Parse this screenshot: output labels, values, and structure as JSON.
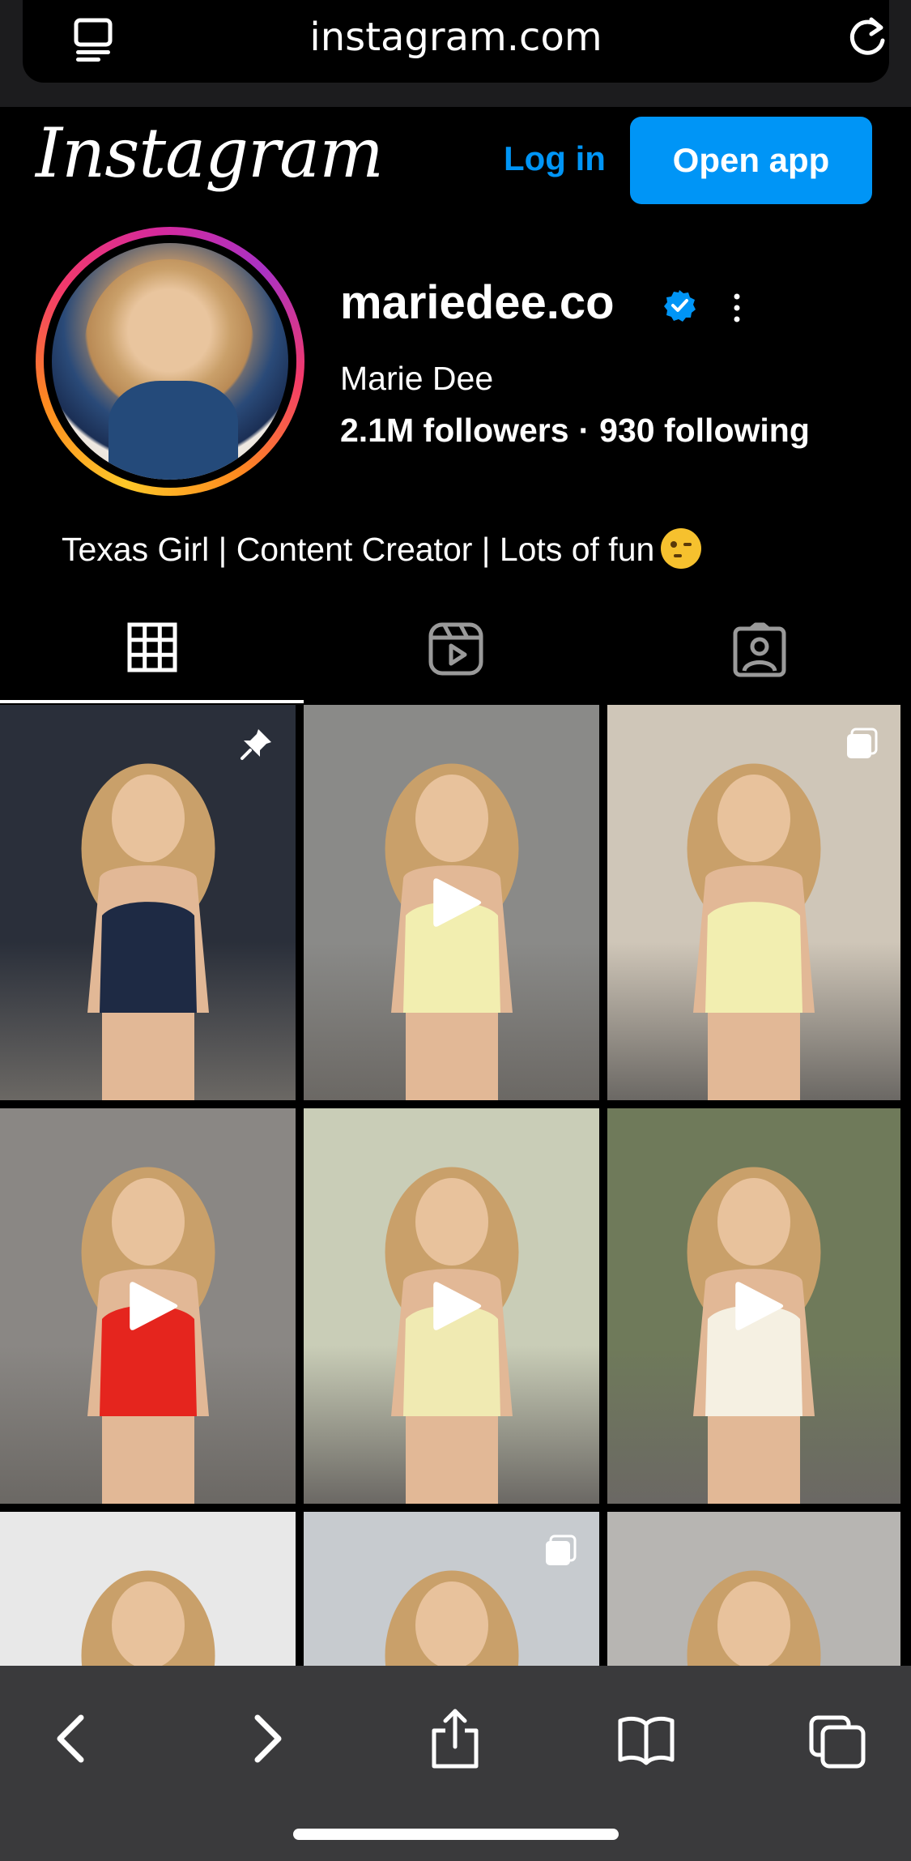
{
  "browser": {
    "url": "instagram.com",
    "reader_icon": "reader-mode-icon",
    "reload_icon": "reload-icon"
  },
  "header": {
    "logo_text": "Instagram",
    "login_label": "Log in",
    "open_app_label": "Open app",
    "accent_color": "#0095f6"
  },
  "profile": {
    "username": "mariedee.co",
    "verified": true,
    "full_name": "Marie Dee",
    "followers": "2.1M followers",
    "separator": "·",
    "following": "930 following",
    "bio": "Texas Girl | Content Creator | Lots of fun"
  },
  "tabs": [
    {
      "name": "posts",
      "icon": "grid-icon",
      "active": true
    },
    {
      "name": "reels",
      "icon": "reels-icon",
      "active": false
    },
    {
      "name": "tagged",
      "icon": "tagged-icon",
      "active": false
    }
  ],
  "posts": [
    {
      "type": "pinned",
      "bg": "#2a2f3a",
      "outfit": "#1e2a44"
    },
    {
      "type": "reel",
      "bg": "#8a8a88",
      "outfit": "#f2eeb0"
    },
    {
      "type": "carousel",
      "bg": "#cfc6b8",
      "outfit": "#f2eeb0"
    },
    {
      "type": "reel",
      "bg": "#8a8784",
      "outfit": "#e5251e"
    },
    {
      "type": "reel",
      "bg": "#c9cdb7",
      "outfit": "#f0eab2"
    },
    {
      "type": "reel",
      "bg": "#6f7a5a",
      "outfit": "#f5f0e2"
    },
    {
      "type": "photo",
      "bg": "#e8e8e8",
      "outfit": "#e9e5e0"
    },
    {
      "type": "carousel",
      "bg": "#c7cbcf",
      "outfit": "#ddd5cc"
    },
    {
      "type": "photo",
      "bg": "#b7b5b2",
      "outfit": "#e2d8c8"
    }
  ],
  "toolbar": {
    "back_icon": "back-icon",
    "forward_icon": "forward-icon",
    "share_icon": "share-icon",
    "bookmarks_icon": "bookmarks-icon",
    "tabs_icon": "tabs-icon"
  }
}
